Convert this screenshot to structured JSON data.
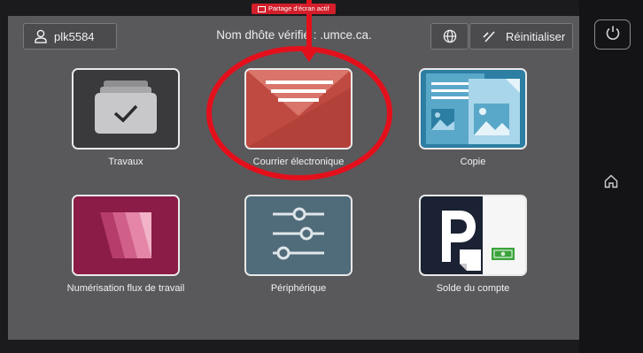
{
  "header": {
    "user_label": "plk5584",
    "host_label": "Nom dhôte vérifié : .umce.ca.",
    "reset_label": "Réinitialiser",
    "share_badge": "Partage d'écran actif"
  },
  "apps": [
    {
      "label": "Travaux",
      "icon": "jobs-folder-icon"
    },
    {
      "label": "Courrier électronique",
      "icon": "email-envelope-icon"
    },
    {
      "label": "Copie",
      "icon": "copy-documents-icon"
    },
    {
      "label": "Numérisation flux de travail",
      "icon": "scan-workflow-icon"
    },
    {
      "label": "Périphérique",
      "icon": "device-sliders-icon"
    },
    {
      "label": "Solde du compte",
      "icon": "account-balance-icon"
    }
  ],
  "side": {
    "power_icon": "power-icon",
    "home_icon": "home-icon"
  },
  "colors": {
    "annotation_red": "#e3101c",
    "screen_bg": "#59595c",
    "email_tile": "#c24a42",
    "copy_tile": "#3a8fb2"
  }
}
